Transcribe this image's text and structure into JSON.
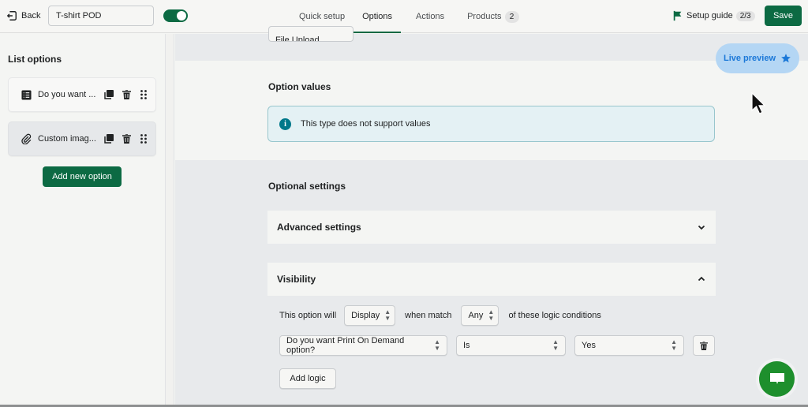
{
  "topbar": {
    "back_label": "Back",
    "product_title": "T-shirt POD",
    "enabled": true,
    "tabs": [
      {
        "label": "Quick setup",
        "active": false
      },
      {
        "label": "Options",
        "active": true
      },
      {
        "label": "Actions",
        "active": false
      },
      {
        "label": "Products",
        "active": false,
        "count": "2"
      }
    ],
    "setup_guide_label": "Setup guide",
    "setup_guide_progress": "2/3",
    "save_label": "Save"
  },
  "sidebar": {
    "title": "List options",
    "options": [
      {
        "label": "Do you want ...",
        "icon": "list-icon",
        "selected": false
      },
      {
        "label": "Custom imag...",
        "icon": "paperclip-icon",
        "selected": true
      }
    ],
    "add_option_label": "Add new option"
  },
  "main": {
    "option_type_label": "File Upload",
    "option_values": {
      "title": "Option values",
      "info_text": "This type does not support values"
    },
    "optional_settings": {
      "title": "Optional settings",
      "advanced_label": "Advanced settings",
      "advanced_expanded": false,
      "visibility_label": "Visibility",
      "visibility_expanded": true,
      "rule_prefix": "This option will",
      "action_value": "Display",
      "match_label": "when match",
      "match_value": "Any",
      "rule_suffix": "of these logic conditions",
      "conditions": [
        {
          "option": "Do you want Print On Demand option?",
          "operator": "Is",
          "value": "Yes"
        }
      ],
      "add_logic_label": "Add logic"
    }
  },
  "live_preview_label": "Live preview",
  "colors": {
    "brand_green": "#0c6a43",
    "info_teal": "#00788a",
    "preview_blue": "#1b78d8",
    "chat_green": "#1e8f2d"
  }
}
